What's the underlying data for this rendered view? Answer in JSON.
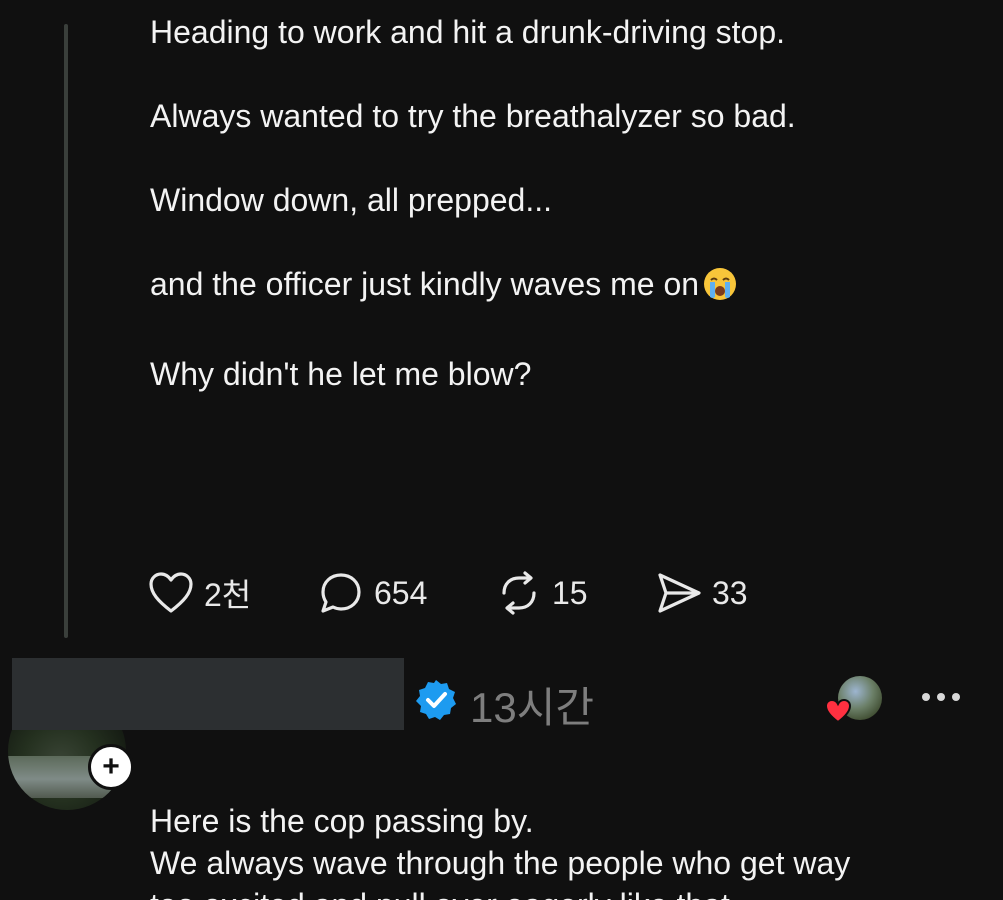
{
  "post": {
    "lines": [
      "Heading to work and hit a drunk-driving stop.",
      "Always wanted to try the breathalyzer so bad.",
      "Window down, all prepped...",
      "and the officer just kindly waves me on",
      "Why didn't he let me blow?"
    ],
    "emoji": "crying-face-emoji",
    "actions": {
      "likes": "2천",
      "replies": "654",
      "reposts": "15",
      "shares": "33"
    }
  },
  "reply": {
    "time": "13시간",
    "lines": [
      "Here is the cop passing by.",
      "We always wave through the people who get way",
      "too excited and pull over eagerly like that."
    ]
  },
  "colors": {
    "background": "#101010",
    "text": "#f3f3f3",
    "muted": "#7e7e7e",
    "verified": "#1d9bf0",
    "heart": "#ff3040"
  },
  "icons": {
    "like": "heart-outline-icon",
    "reply": "speech-bubble-icon",
    "repost": "repost-icon",
    "share": "send-icon",
    "verified": "verified-badge-icon",
    "more": "more-horizontal-icon",
    "follow": "plus-icon"
  }
}
